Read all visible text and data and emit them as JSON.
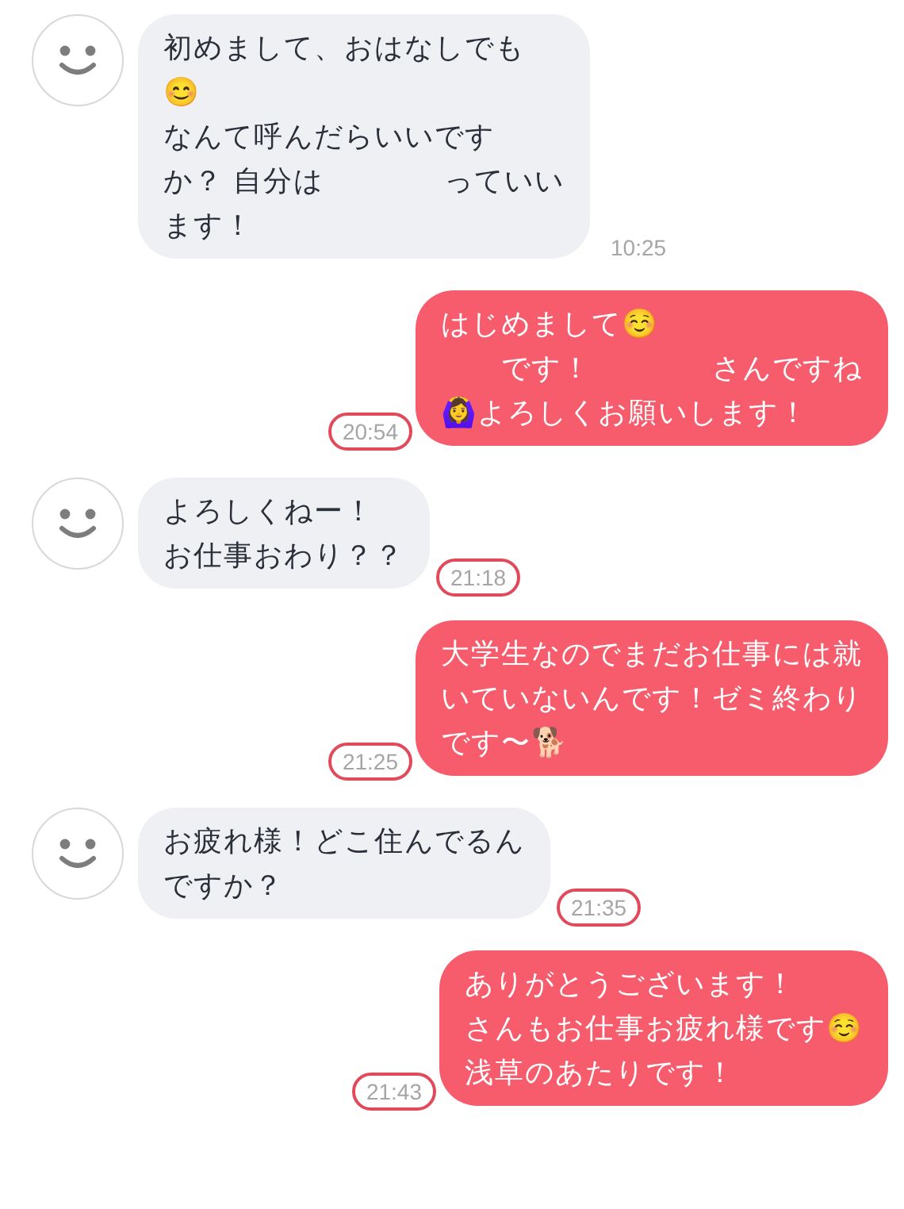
{
  "messages": [
    {
      "kind": "incoming",
      "lines": [
        "初めまして、おはなしでも",
        "😊",
        "なんて呼んだらいいです",
        "か？ 自分は　　　　っていい",
        "ます！"
      ],
      "time": "10:25",
      "circled": false
    },
    {
      "kind": "outgoing",
      "lines": [
        "はじめまして☺️",
        "　　です！　　　　さんですね",
        "🙆‍♀️よろしくお願いします！"
      ],
      "time": "20:54",
      "circled": true
    },
    {
      "kind": "incoming",
      "lines": [
        "よろしくねー！",
        "お仕事おわり？？"
      ],
      "time": "21:18",
      "circled": true
    },
    {
      "kind": "outgoing",
      "lines": [
        "大学生なのでまだお仕事には就",
        "いていないんです！ゼミ終わり",
        "です〜🐕"
      ],
      "time": "21:25",
      "circled": true
    },
    {
      "kind": "incoming",
      "lines": [
        "お疲れ様！どこ住んでるん",
        "ですか？"
      ],
      "time": "21:35",
      "circled": true
    },
    {
      "kind": "outgoing",
      "lines": [
        "ありがとうございます！",
        "さんもお仕事お疲れ様です☺️",
        "浅草のあたりです！"
      ],
      "time": "21:43",
      "circled": true
    }
  ]
}
